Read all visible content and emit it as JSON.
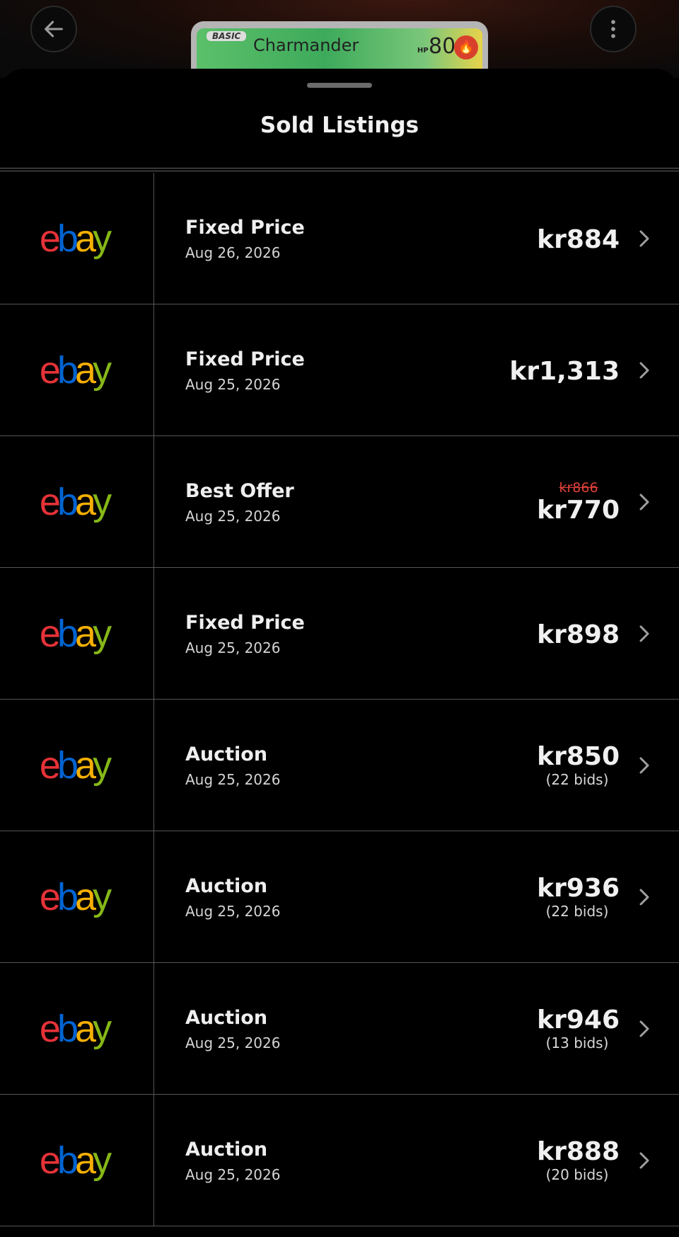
{
  "header": {
    "back_icon": "arrow-left-icon",
    "menu_icon": "more-vertical-icon",
    "card": {
      "stage": "BASIC",
      "name": "Charmander",
      "hp_label": "HP",
      "hp": "80",
      "type_icon": "fire-energy-icon"
    }
  },
  "sheet": {
    "title": "Sold Listings"
  },
  "listings": [
    {
      "source": "ebay",
      "type": "Fixed Price",
      "date": "Aug 26, 2026",
      "price": "kr884",
      "original_price": "",
      "bids": ""
    },
    {
      "source": "ebay",
      "type": "Fixed Price",
      "date": "Aug 25, 2026",
      "price": "kr1,313",
      "original_price": "",
      "bids": ""
    },
    {
      "source": "ebay",
      "type": "Best Offer",
      "date": "Aug 25, 2026",
      "price": "kr770",
      "original_price": "kr866",
      "bids": ""
    },
    {
      "source": "ebay",
      "type": "Fixed Price",
      "date": "Aug 25, 2026",
      "price": "kr898",
      "original_price": "",
      "bids": ""
    },
    {
      "source": "ebay",
      "type": "Auction",
      "date": "Aug 25, 2026",
      "price": "kr850",
      "original_price": "",
      "bids": "(22 bids)"
    },
    {
      "source": "ebay",
      "type": "Auction",
      "date": "Aug 25, 2026",
      "price": "kr936",
      "original_price": "",
      "bids": "(22 bids)"
    },
    {
      "source": "ebay",
      "type": "Auction",
      "date": "Aug 25, 2026",
      "price": "kr946",
      "original_price": "",
      "bids": "(13 bids)"
    },
    {
      "source": "ebay",
      "type": "Auction",
      "date": "Aug 25, 2026",
      "price": "kr888",
      "original_price": "",
      "bids": "(20 bids)"
    }
  ],
  "colors": {
    "background": "#000000",
    "strikethrough_price": "#e0413a",
    "ebay_e": "#e53238",
    "ebay_b": "#0064d2",
    "ebay_a": "#f5af02",
    "ebay_y": "#86b817"
  }
}
